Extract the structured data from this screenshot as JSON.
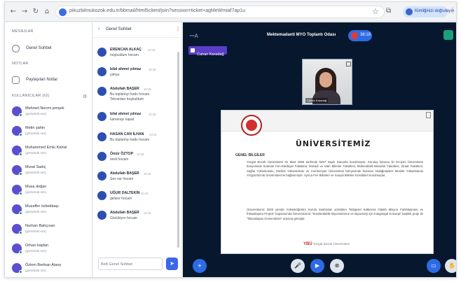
{
  "browser": {
    "nav": [
      "←",
      "→",
      "↻",
      "⌂"
    ],
    "url": "pikuzbilmukozok.edu.tr/bbmail/html5client/join?session=ticket+agMeWmiaf7ap1u",
    "profile_label": "Kimliğinizi doğrulayın",
    "star": "☆",
    "ext": "⧉",
    "menu": "⋮"
  },
  "left": {
    "messages_title": "MESAJLAR",
    "public_chat_label": "Genel Sohbet",
    "notes_title": "NOTLAR",
    "shared_notes_label": "Paylaşılan Notlar",
    "users_title": "KULLANICILAR (62)",
    "gear": "⚙",
    "users": [
      {
        "name": "Mehmet Necmi şimşek",
        "detail": "(görüntülü ses)"
      },
      {
        "name": "Metin şahin",
        "detail": "(görüntülü ses)"
      },
      {
        "name": "Muhammed Emlu Kartal",
        "detail": "(görüntülü ses)"
      },
      {
        "name": "Murat Sadıç",
        "detail": "(görüntülü ses)"
      },
      {
        "name": "Musa doğan",
        "detail": "(görüntülü ses)"
      },
      {
        "name": "Muzaffer özbekbaşı",
        "detail": "(görüntülü ses)"
      },
      {
        "name": "Nurhan Bahçıvan",
        "detail": "(görüntülü ses)"
      },
      {
        "name": "Orhan kaplan",
        "detail": "(görüntülü ses)"
      },
      {
        "name": "Özlem Berikan Ataoy",
        "detail": "(görüntülü ses)"
      }
    ]
  },
  "chat": {
    "back": "‹",
    "title": "Genel Sohbet",
    "dots": "⋮",
    "messages": [
      {
        "name": "ERENCAN ALKAÇ",
        "time": "10:15",
        "lines": [
          "hoşbuldum hocam"
        ]
      },
      {
        "name": "bilal ahmet yılmaz",
        "time": "10:15",
        "lines": [
          "yahya"
        ]
      },
      {
        "name": "Abdullah BAŞER",
        "time": "10:15",
        "lines": [
          "Bu toplantıyı katkı hocam.",
          "Tekrardan hoşbuldum"
        ]
      },
      {
        "name": "bilal ahmet yılmaz",
        "time": "10:15",
        "lines": [
          "kamerayı kapat"
        ]
      },
      {
        "name": "HASAN CAN İLHAN",
        "time": "10:15",
        "lines": [
          "Bu toplantıyı katkı hocam"
        ]
      },
      {
        "name": "Ömür ÖZTOP",
        "time": "10:16",
        "lines": [
          "sesli hocam"
        ]
      },
      {
        "name": "Abdullah BAŞER",
        "time": "10:16",
        "lines": [
          "Ses var hocam"
        ]
      },
      {
        "name": "UĞUR DALTEKİN",
        "time": "10:16",
        "lines": [
          "geliyor hocam"
        ]
      },
      {
        "name": "Abdullah BAŞER",
        "time": "10:16",
        "lines": [
          "Gözükiyor hocam"
        ]
      }
    ],
    "input_placeholder": "Bett Genel Sohbet",
    "send": "➤"
  },
  "meeting": {
    "title": "Mektemadanti MYO Toplantı Odası",
    "rec_time": "38:18",
    "presenter_badge": "Canan Karadağ",
    "webcam_name": "Canan Karadağ",
    "left_icon": "ꟷA",
    "controls": {
      "plus": "+",
      "mic": "🎤",
      "cam": "▶",
      "screen": "⊗",
      "present": "▭",
      "hand": "✋"
    }
  },
  "slide": {
    "heading": "ÜNİVERSİTEMİZ",
    "subheading": "GENEL BİLGİLER",
    "para1": "Yozgat Bozok Üniversitesi 01 Mart 2006 tarihinde 5467 Sayılı Kanunla kurulmuştur. Kuruluş kanunu ile Erciyes Üniversitesi bünyesinde bulunan Fen-Edebiyat Fakültesi, İktisadi ve İdari Bilimler Fakültesi, Mühendislik-Mimarlık Fakültesi, Ziraat Fakültesi, Sağlık Yüksekokulu, Meslek Yüksekokulu ve Cumhuriyeti Üniversitesi bünyesinde bulunan Akdağmadeni Meslek Yüksekokulu Yozgat Bozok Üniversitesi'ne bağlanmıştır. Ayrıca Fen Bilimleri ve Sosyal Bilimler Enstitüleri kurulmuştur.",
    "para2": "Üniversitemiz 2020 yılında Yükseköğretim Kurulu tarafından yürütülen \"Bölgesel Kalkınma Odaklı Misyon Farklılaşması ve İhtisaslaşma Projesi\" kapsamında Üniversitemiz \"Sürdürülebilir Biyomalzeme ve Biyoenerji için İntegratyal Konsept\" başlıklı proje ile \"İhtisaslaşan Üniversiteler\" arasına girmiştir.",
    "foot_logo": "YBÜ",
    "foot_text": "Yozgat Bozok Üniversitesi"
  }
}
